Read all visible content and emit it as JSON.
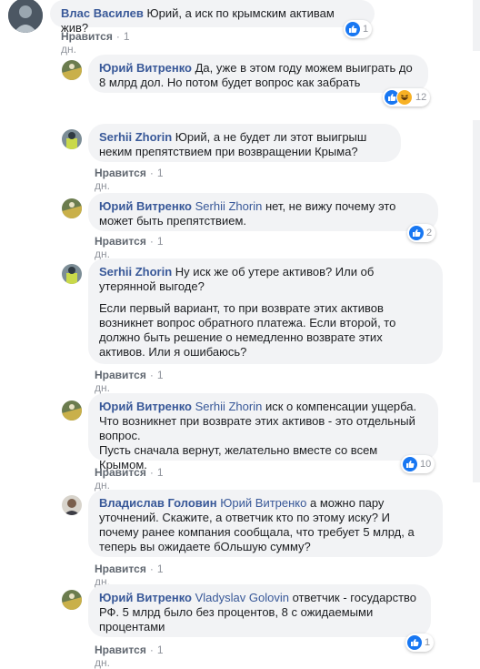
{
  "like_label": "Нравится",
  "comments": [
    {
      "author": "Влас Василев",
      "text": "Юрий, а иск по крымским активам жив?",
      "time": "1 дн.",
      "reactions": "1"
    },
    {
      "author": "Юрий Витренко",
      "text": "Да, уже в этом году можем выиграть до 8 млрд дол. Но потом будет вопрос как забрать",
      "reactions": "12"
    },
    {
      "author": "Serhii Zhorin",
      "text": "Юрий, а не будет ли этот выигрыш неким препятствием при возвращении Крыма?",
      "time": "1 дн."
    },
    {
      "author": "Юрий Витренко",
      "mention": "Serhii Zhorin",
      "text": "нет, не вижу почему это может быть препятствием.",
      "time": "1 дн.",
      "reactions": "2"
    },
    {
      "author": "Serhii Zhorin",
      "text": "Ну иск же об утере активов? Или об утерянной выгоде?",
      "text2": "Если первый вариант, то при возврате этих активов возникнет вопрос обратного платежа. Если второй, то должно быть решение о немедленно возврате этих активов. Или я ошибаюсь?",
      "time": "1 дн."
    },
    {
      "author": "Юрий Витренко",
      "mention": "Serhii Zhorin",
      "text": "иск о компенсации ущерба. Что возникнет при возврате этих активов - это отдельный вопрос.",
      "text2": "Пусть сначала вернут, желательно вместе со всем Крымом.",
      "time": "1 дн.",
      "reactions": "10"
    },
    {
      "author": "Владислав Головин",
      "mention": "Юрий Витренко",
      "text": "а можно пару уточнений. Скажите, а ответчик кто по этому иску? И почему ранее компания сообщала, что требует 5 млрд, а теперь вы ожидаете бОльшую сумму?",
      "time": "1 дн."
    },
    {
      "author": "Юрий Витренко",
      "mention": "Vladyslav Golovin",
      "text": "ответчик - государство РФ. 5 млрд было без процентов, 8 с ожидаемыми процентами",
      "time": "1 дн.",
      "reactions": "1"
    }
  ]
}
